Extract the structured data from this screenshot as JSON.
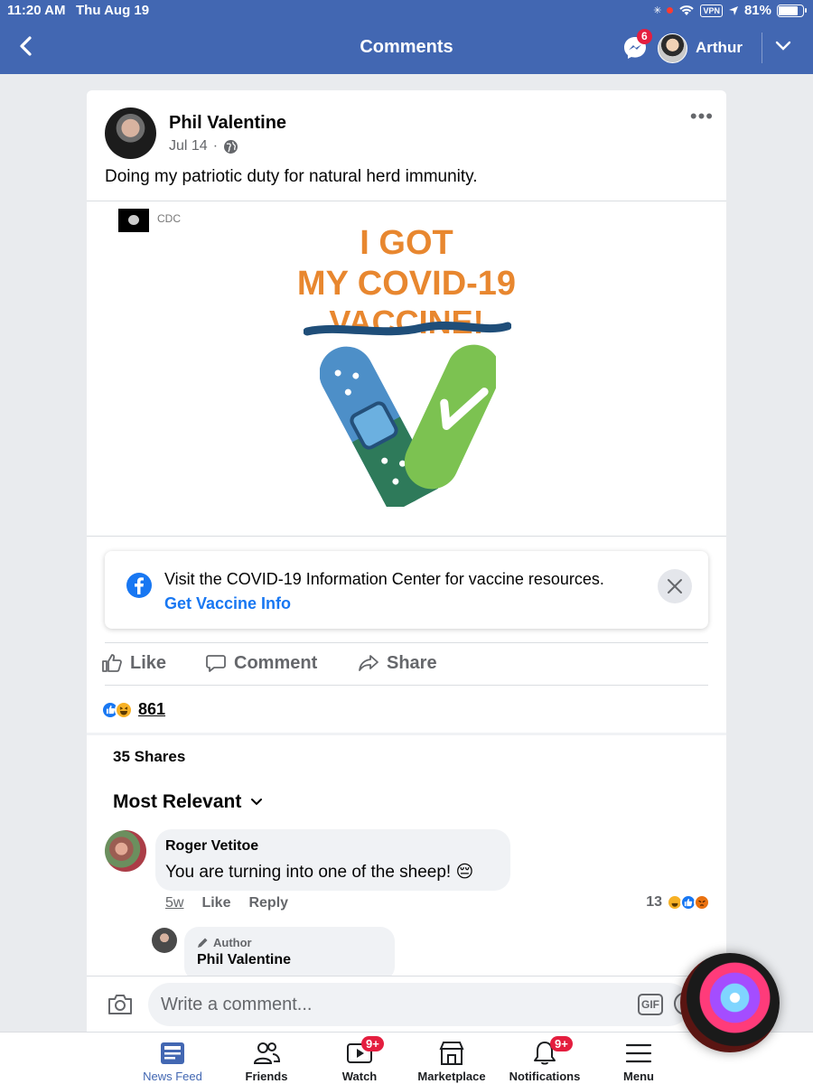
{
  "status_bar": {
    "time": "11:20 AM",
    "date": "Thu Aug 19",
    "vpn": "VPN",
    "battery": "81%",
    "battery_level": 0.81
  },
  "header": {
    "title": "Comments",
    "messenger_badge": "6",
    "user_name": "Arthur"
  },
  "post": {
    "author": "Phil Valentine",
    "date": "Jul 14",
    "separator": "·",
    "text": "Doing my patriotic duty for natural herd immunity.",
    "media": {
      "source": "CDC",
      "line1": "I GOT",
      "line2": "MY COVID-19",
      "line3_crossed": "VACCINE!"
    }
  },
  "info_box": {
    "text": "Visit the COVID-19 Information Center for vaccine resources.",
    "link": "Get Vaccine Info"
  },
  "actions": {
    "like": "Like",
    "comment": "Comment",
    "share": "Share"
  },
  "stats": {
    "reaction_count": "861",
    "shares": "35 Shares"
  },
  "comments_section": {
    "sort_label": "Most Relevant"
  },
  "comments": [
    {
      "name": "Roger Vetitoe",
      "text": "You are turning into one of the sheep! 😔",
      "time": "5w",
      "like": "Like",
      "reply": "Reply",
      "reaction_count": "13"
    }
  ],
  "reply": {
    "badge": "Author",
    "name": "Phil Valentine"
  },
  "composer": {
    "placeholder": "Write a comment...",
    "gif": "GIF"
  },
  "bottom_nav": [
    {
      "label": "News Feed",
      "icon": "news-feed-icon",
      "badge": ""
    },
    {
      "label": "Friends",
      "icon": "friends-icon",
      "badge": ""
    },
    {
      "label": "Watch",
      "icon": "watch-icon",
      "badge": "9+"
    },
    {
      "label": "Marketplace",
      "icon": "marketplace-icon",
      "badge": ""
    },
    {
      "label": "Notifications",
      "icon": "bell-icon",
      "badge": "9+"
    },
    {
      "label": "Menu",
      "icon": "menu-icon",
      "badge": ""
    }
  ],
  "colors": {
    "brand": "#4267b2",
    "link": "#1877f2",
    "badge": "#e41e3f",
    "vaccine_text": "#e8872f"
  }
}
